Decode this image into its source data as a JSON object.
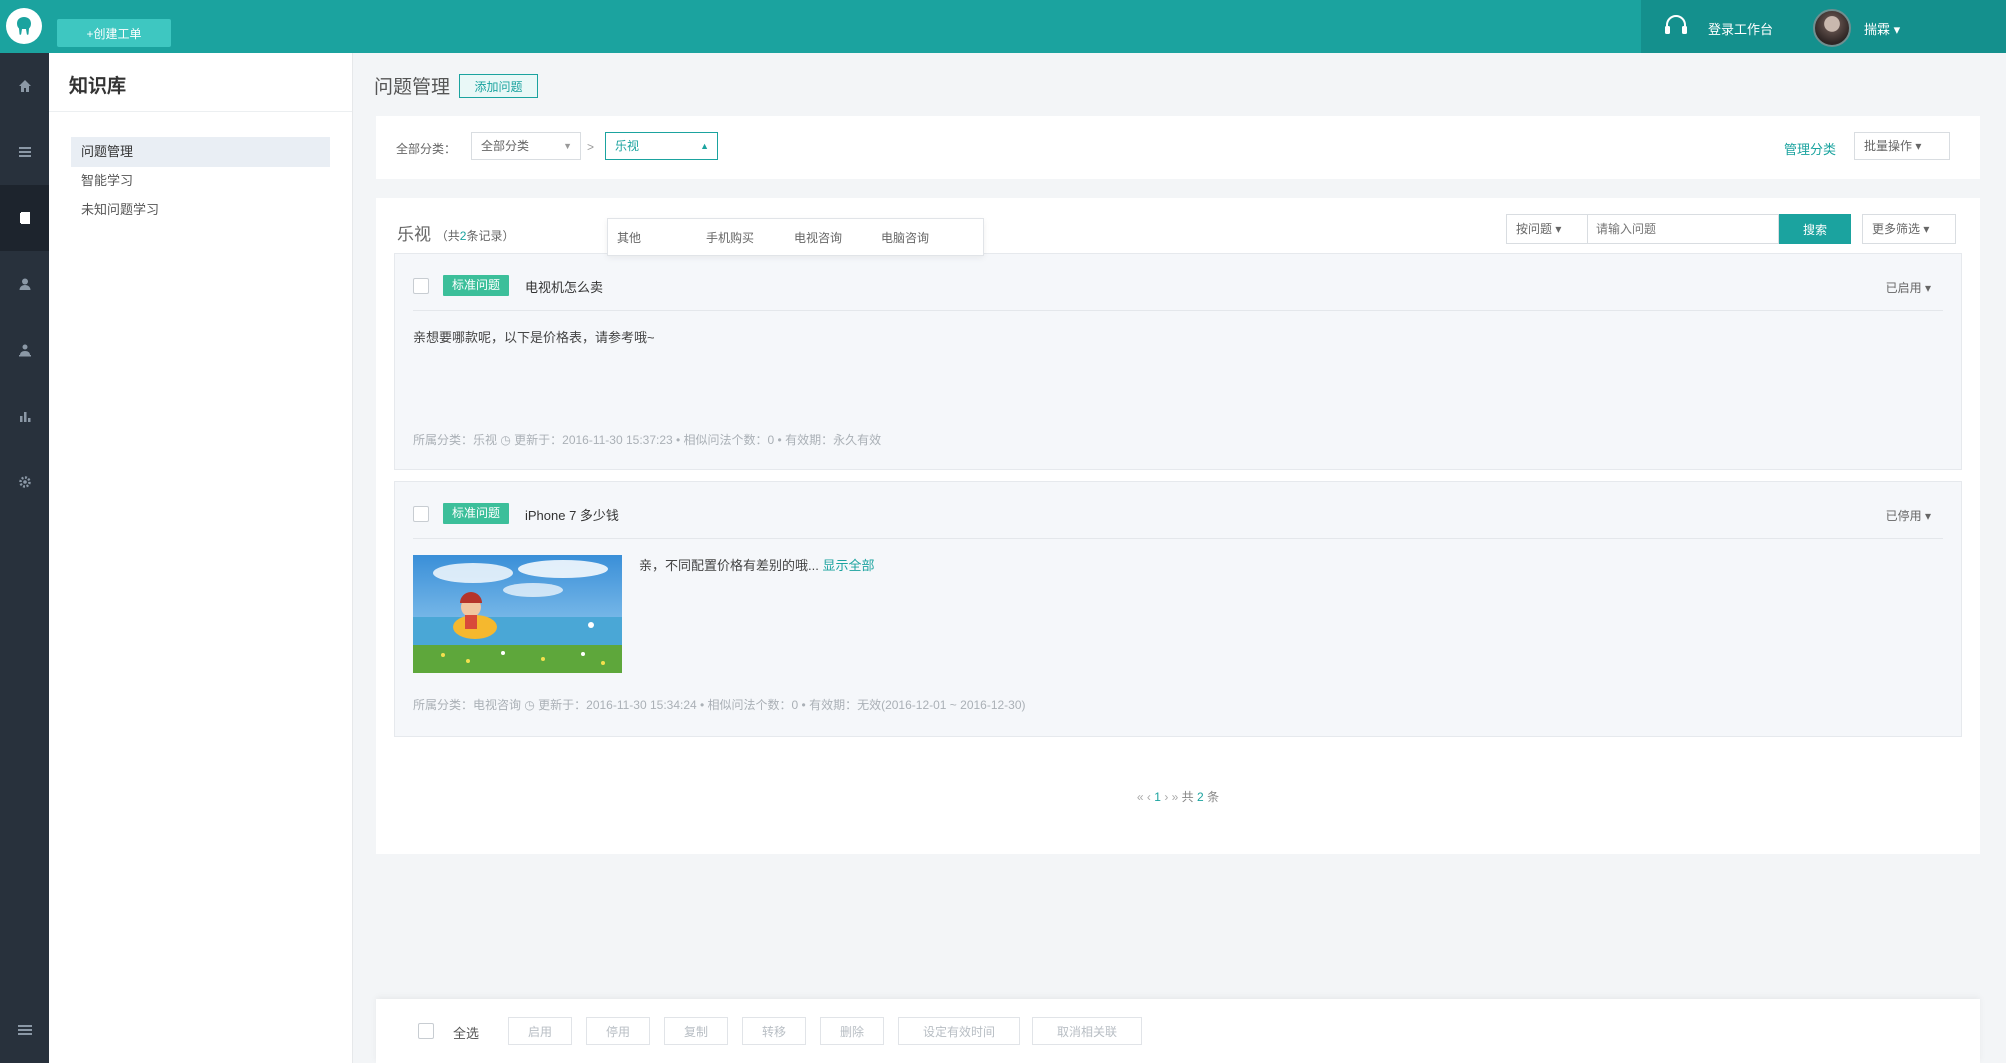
{
  "topbar": {
    "new_ticket": "+创建工单",
    "workspace": "登录工作台",
    "user": "揣霖 ▾"
  },
  "rail": {
    "icons": [
      "home-icon",
      "list-icon",
      "book-icon",
      "user-icon",
      "users-icon",
      "chart-icon",
      "gear-icon",
      "menu-icon"
    ]
  },
  "sidebar": {
    "title": "知识库",
    "items": [
      {
        "label": "问题管理",
        "active": true
      },
      {
        "label": "智能学习",
        "active": false
      },
      {
        "label": "未知问题学习",
        "active": false
      }
    ]
  },
  "main": {
    "title": "问题管理",
    "add_button": "添加问题"
  },
  "filter": {
    "label": "全部分类：",
    "category_select": "全部分类",
    "separator": ">",
    "sub_select": "乐视",
    "manage": "管理分类",
    "batch": "批量操作 ▾",
    "dropdown_options": [
      "其他",
      "手机购买",
      "电视咨询",
      "电脑咨询"
    ]
  },
  "list": {
    "heading": "乐视",
    "count_prefix": "（共",
    "count": "2",
    "count_suffix": "条记录）",
    "search_type": "按问题 ▾",
    "search_placeholder": "请输入问题",
    "search_button": "搜索",
    "more_filter": "更多筛选 ▾"
  },
  "cards": [
    {
      "tag": "标准问题",
      "title": "电视机怎么卖",
      "status": "已启用 ▾",
      "body": "亲想要哪款呢，以下是价格表，请参考哦~",
      "meta": "所属分类：乐视  ◷ 更新于：2016-11-30 15:37:23  •  相似问法个数：0  •  有效期：永久有效"
    },
    {
      "tag": "标准问题",
      "title": "iPhone 7 多少钱",
      "status": "已停用 ▾",
      "body": "亲，不同配置价格有差别的哦...",
      "show_all": "显示全部",
      "meta": "所属分类：电视咨询  ◷ 更新于：2016-11-30 15:34:24  •  相似问法个数：0  •  有效期：无效(2016-12-01 ~ 2016-12-30)"
    }
  ],
  "pager": {
    "prev": "« ‹",
    "current": "1",
    "next": "› »",
    "total_prefix": "共",
    "total": "2",
    "total_suffix": "条"
  },
  "batch_bar": {
    "select_all": "全选",
    "buttons": [
      "启用",
      "停用",
      "复制",
      "转移",
      "删除",
      "设定有效时间",
      "取消相关联"
    ]
  },
  "colors": {
    "brand": "#1ba39f",
    "tag": "#3cbf9a",
    "rail": "#28313c"
  }
}
